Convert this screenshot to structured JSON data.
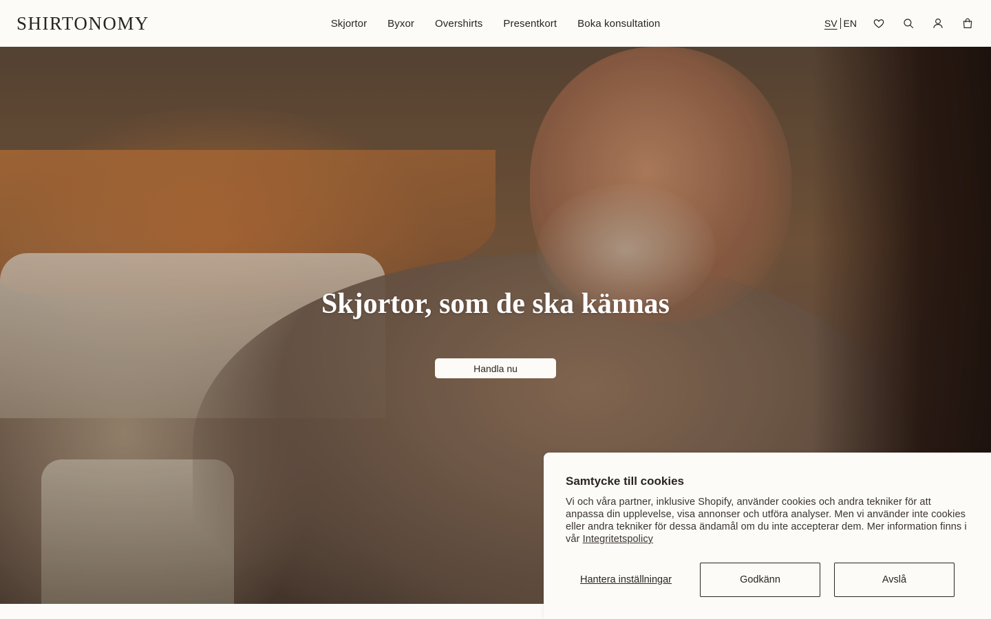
{
  "header": {
    "logo": "SHIRTONOMY",
    "nav": [
      "Skjortor",
      "Byxor",
      "Overshirts",
      "Presentkort",
      "Boka konsultation"
    ],
    "lang_active": "SV",
    "lang_other": "EN",
    "icons": [
      "heart-icon",
      "search-icon",
      "account-icon",
      "bag-icon"
    ]
  },
  "hero": {
    "title": "Skjortor, som de ska kännas",
    "cta": "Handla nu"
  },
  "cookie": {
    "title": "Samtycke till cookies",
    "body": "Vi och våra partner, inklusive Shopify, använder cookies och andra tekniker för att anpassa din upplevelse, visa annonser och utföra analyser. Men vi använder inte cookies eller andra tekniker för dessa ändamål om du inte accepterar dem. Mer information finns i vår ",
    "policy_link": "Integritetspolicy",
    "manage": "Hantera inställningar",
    "accept": "Godkänn",
    "decline": "Avslå"
  }
}
